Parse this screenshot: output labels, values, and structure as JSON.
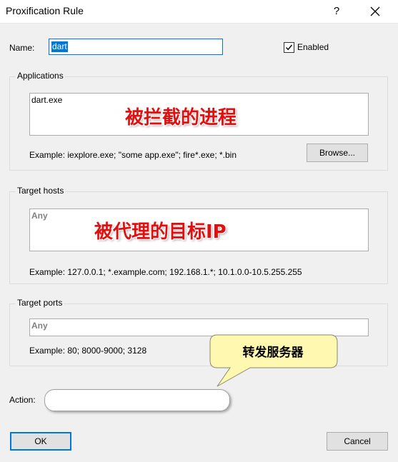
{
  "window": {
    "title": "Proxification Rule",
    "help_glyph": "?"
  },
  "name": {
    "label": "Name:",
    "value": "dart"
  },
  "enabled": {
    "label": "Enabled",
    "checked": true
  },
  "applications": {
    "group_title": "Applications",
    "value": "dart.exe",
    "example": "Example: iexplore.exe; \"some app.exe\"; fire*.exe; *.bin",
    "browse_label": "Browse...",
    "annotation": "被拦截的进程"
  },
  "target_hosts": {
    "group_title": "Target hosts",
    "placeholder": "Any",
    "example": "Example: 127.0.0.1; *.example.com; 192.168.1.*; 10.1.0.0-10.5.255.255",
    "annotation": "被代理的目标IP"
  },
  "target_ports": {
    "group_title": "Target ports",
    "placeholder": "Any",
    "example": "Example: 80; 8000-9000; 3128"
  },
  "action": {
    "label": "Action:",
    "value": "",
    "callout": "转发服务器"
  },
  "footer": {
    "ok_label": "OK",
    "cancel_label": "Cancel"
  },
  "colors": {
    "accent": "#0078d7",
    "annotation_red": "#e01010",
    "callout_fill": "#fff8b0"
  },
  "icons": {
    "close": "close-icon",
    "check": "checkmark-icon"
  }
}
